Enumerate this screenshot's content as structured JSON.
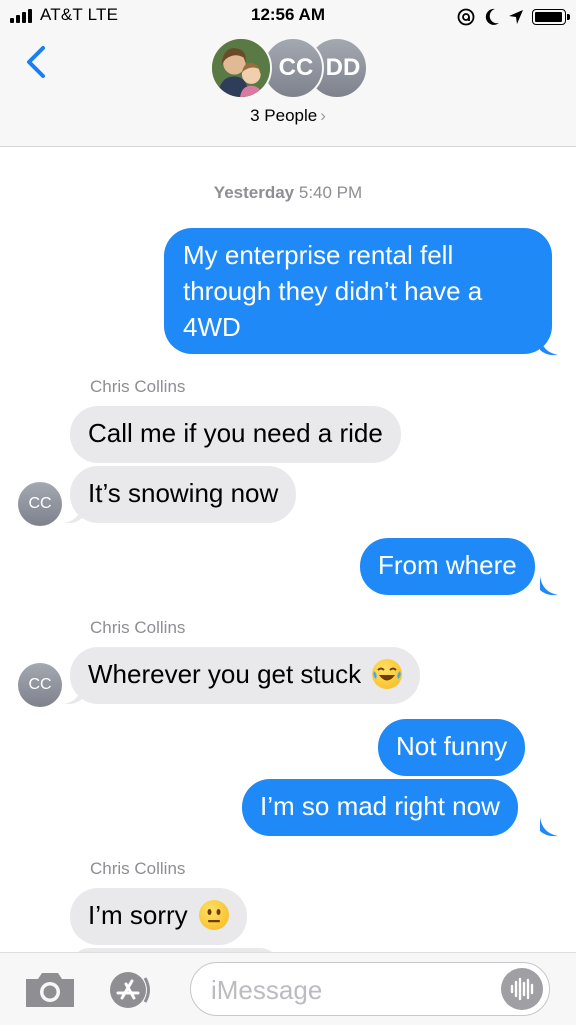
{
  "status_bar": {
    "carrier": "AT&T LTE",
    "time": "12:56 AM"
  },
  "header": {
    "avatars": [
      "CC",
      "DD"
    ],
    "participants_label": "3 People",
    "participants_chevron": "›"
  },
  "conversation": {
    "timestamp_day": "Yesterday",
    "timestamp_time": "5:40 PM",
    "messages": [
      {
        "from": "me",
        "lines": [
          "My enterprise rental fell",
          "through they didn’t have a",
          "4WD"
        ]
      },
      {
        "from": "Chris Collins",
        "sender_label": "Chris Collins",
        "text": "Call me if you need a ride"
      },
      {
        "from": "Chris Collins",
        "text": "It’s snowing now",
        "avatar": "CC"
      },
      {
        "from": "me",
        "text": "From where"
      },
      {
        "from": "Chris Collins",
        "sender_label": "Chris Collins",
        "text": "Wherever you get stuck",
        "emoji": "face-with-tears-of-joy",
        "avatar": "CC"
      },
      {
        "from": "me",
        "text": "Not funny"
      },
      {
        "from": "me",
        "text": "I’m so mad right now"
      },
      {
        "from": "Chris Collins",
        "sender_label": "Chris Collins",
        "text": "I’m sorry",
        "emoji": "neutral-face"
      }
    ]
  },
  "composer": {
    "placeholder": "iMessage"
  },
  "colors": {
    "outgoing_bubble": "#1f8af7",
    "incoming_bubble": "#e9e9eb",
    "ios_blue": "#1a7ef5",
    "meta_gray": "#8e8e93"
  },
  "icons": [
    "signal-icon",
    "alarm-icon",
    "moon-icon",
    "location-icon",
    "battery-icon",
    "back-chevron-icon",
    "camera-icon",
    "app-store-icon",
    "audio-waveform-icon"
  ]
}
